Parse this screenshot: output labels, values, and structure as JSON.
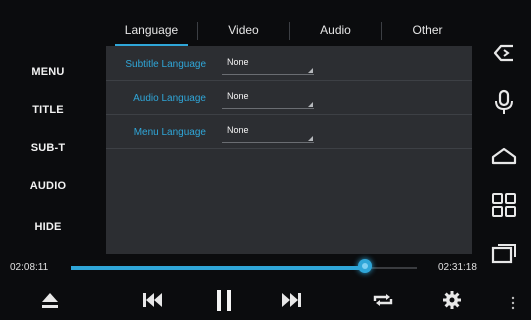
{
  "left_menu": {
    "items": [
      {
        "label": "MENU"
      },
      {
        "label": "TITLE"
      },
      {
        "label": "SUB-T"
      },
      {
        "label": "AUDIO"
      },
      {
        "label": "HIDE"
      }
    ]
  },
  "tabs": [
    {
      "label": "Language",
      "active": true
    },
    {
      "label": "Video",
      "active": false
    },
    {
      "label": "Audio",
      "active": false
    },
    {
      "label": "Other",
      "active": false
    }
  ],
  "settings": {
    "rows": [
      {
        "label": "Subtitle Language",
        "value": "None"
      },
      {
        "label": "Audio Language",
        "value": "None"
      },
      {
        "label": "Menu Language",
        "value": "None"
      }
    ]
  },
  "playback": {
    "current_time": "02:08:11",
    "total_time": "02:31:18",
    "progress": 0.85
  },
  "nav_icons": [
    "back-icon",
    "microphone-icon",
    "home-icon",
    "apps-grid-icon",
    "recent-apps-icon"
  ],
  "controls": [
    "eject-icon",
    "previous-icon",
    "pause-icon",
    "next-icon",
    "repeat-icon",
    "settings-gear-icon"
  ],
  "colors": {
    "accent": "#2fa6d8",
    "panel": "#2c2e32",
    "background": "#0b0c0e"
  }
}
